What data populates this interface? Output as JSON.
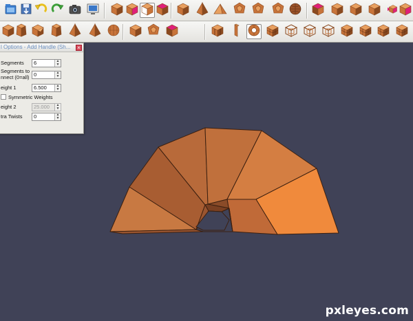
{
  "colors": {
    "viewport_bg": "#404257",
    "model_orange": "#c77a42",
    "model_highlight": "#f08a3c",
    "edge": "#3c2010",
    "pink_accent": "#e0207a"
  },
  "toolbar_top": {
    "buttons": [
      {
        "name": "open-file-icon",
        "kind": "file"
      },
      {
        "name": "save-file-icon",
        "kind": "save"
      },
      {
        "name": "undo-icon",
        "kind": "undo"
      },
      {
        "name": "redo-icon",
        "kind": "redo"
      },
      {
        "name": "screenshot-camera-icon",
        "kind": "camera"
      },
      {
        "name": "render-view-icon",
        "kind": "monitor"
      },
      {
        "name": "view-mode-solid-icon",
        "kind": "cube"
      },
      {
        "name": "view-mode-pink-icon",
        "kind": "cube-pink"
      },
      {
        "name": "view-mode-faces-icon",
        "kind": "cube-face",
        "active": true
      },
      {
        "name": "view-mode-magenta-icon",
        "kind": "cube-magenta"
      },
      {
        "name": "cube-primitive-icon",
        "kind": "cube"
      },
      {
        "name": "pyramid-primitive-icon",
        "kind": "pyramid"
      },
      {
        "name": "tetrahedron-primitive-icon",
        "kind": "tetra"
      },
      {
        "name": "dodecahedron-primitive-icon",
        "kind": "dodeca"
      },
      {
        "name": "pentagon-prism-icon",
        "kind": "dodeca"
      },
      {
        "name": "geodesic-primitive-icon",
        "kind": "dodeca"
      },
      {
        "name": "sphere-primitive-icon",
        "kind": "sphere"
      },
      {
        "name": "select-faces-icon",
        "kind": "cube-face-pink"
      },
      {
        "name": "select-edges-icon",
        "kind": "cube"
      },
      {
        "name": "select-vertices-icon",
        "kind": "cube"
      },
      {
        "name": "select-object-icon",
        "kind": "cube"
      },
      {
        "name": "select-multi-icon",
        "kind": "cube-multi"
      },
      {
        "name": "select-pink-icon",
        "kind": "cube-pink"
      }
    ]
  },
  "toolbar_bottom": {
    "buttons": [
      {
        "name": "extrude-tool-icon",
        "kind": "cube"
      },
      {
        "name": "bevel-tool-icon",
        "kind": "cube-tall"
      },
      {
        "name": "wedge-tool-icon",
        "kind": "cube-bevel"
      },
      {
        "name": "taper-tool-icon",
        "kind": "cube-tall"
      },
      {
        "name": "spike-tool-icon",
        "kind": "pyramid"
      },
      {
        "name": "point-tool-icon",
        "kind": "pyramid"
      },
      {
        "name": "sphere-tool-icon",
        "kind": "sphere-grid"
      },
      {
        "name": "inset-tool-icon",
        "kind": "cube"
      },
      {
        "name": "chamfer-tool-icon",
        "kind": "dodeca"
      },
      {
        "name": "add-handle-pink-icon",
        "kind": "cube-face-pink"
      },
      {
        "name": "split-tool-icon",
        "kind": "cube-split"
      },
      {
        "name": "slice-tool-icon",
        "kind": "slab"
      },
      {
        "name": "add-handle-icon",
        "kind": "torus",
        "active": true
      },
      {
        "name": "lattice-tool-icon",
        "kind": "cube-grid"
      },
      {
        "name": "cage-tool-icon",
        "kind": "cube-wire"
      },
      {
        "name": "frame-tool-icon",
        "kind": "cube-wire"
      },
      {
        "name": "wireframe-tool-icon",
        "kind": "cube-wire"
      },
      {
        "name": "hollow-tool-icon",
        "kind": "cube-grid"
      },
      {
        "name": "window-tool-icon",
        "kind": "cube-grid"
      },
      {
        "name": "grid-tool-icon",
        "kind": "cube-grid"
      },
      {
        "name": "mesh-tool-icon",
        "kind": "cube-grid"
      }
    ]
  },
  "dialog": {
    "title": "l Options - Add Handle (Sh...",
    "close": "×",
    "segments": {
      "label": "Segments",
      "value": "6"
    },
    "segments_connect": {
      "label_line1": "Segments to",
      "label_line2": "nnect (0=all)",
      "value": "0"
    },
    "weight1": {
      "label": "eight 1",
      "value": "6.500"
    },
    "symmetric": {
      "label": "Symmetric Weights",
      "checked": false
    },
    "weight2": {
      "label": "eight 2",
      "value": "25.000"
    },
    "extra_twists": {
      "label": "tra Twists",
      "value": "0"
    }
  },
  "watermark": "pxleyes.com"
}
